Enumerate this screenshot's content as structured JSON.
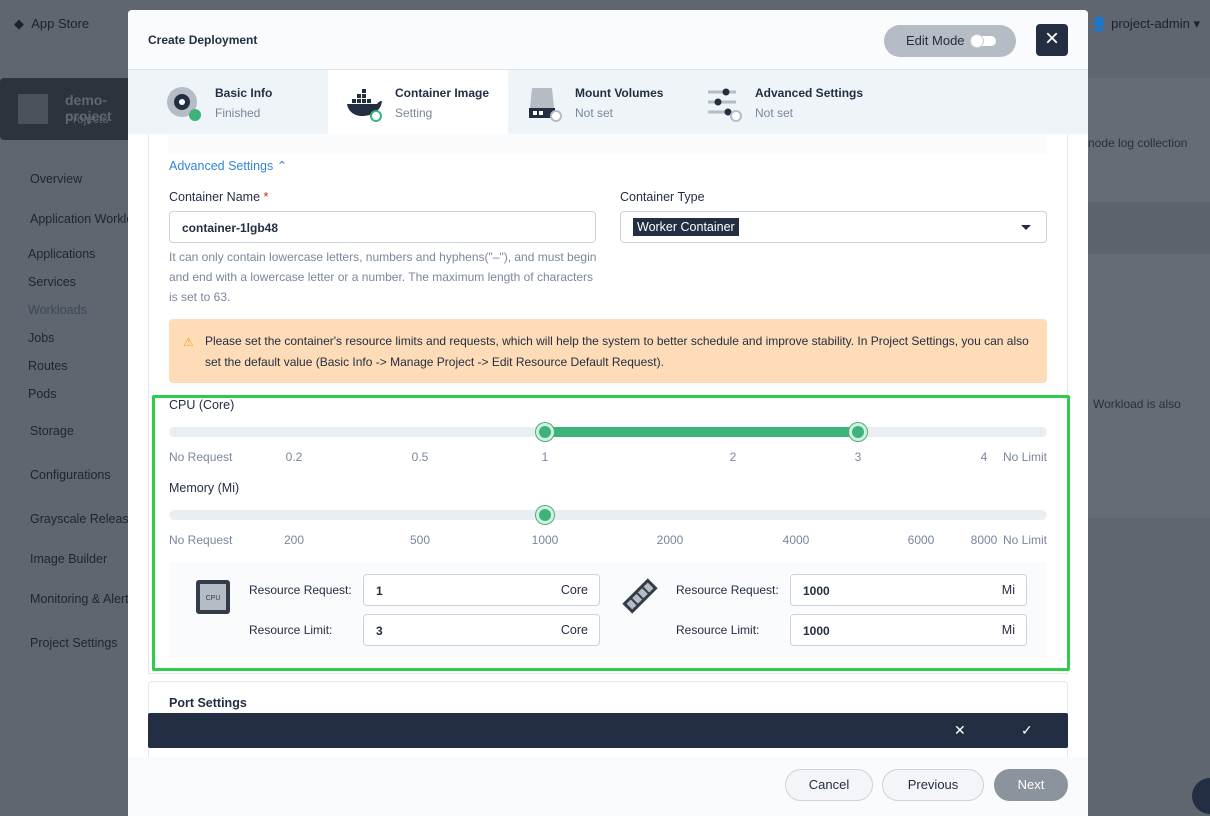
{
  "background": {
    "app_store": "App Store",
    "user": "project-admin",
    "project_name": "demo-project",
    "project_type": "Projects",
    "nav": [
      "Overview",
      "Application Workloads",
      "Applications",
      "Services",
      "Workloads",
      "Jobs",
      "Routes",
      "Pods",
      "Storage",
      "Configurations",
      "Grayscale Release",
      "Image Builder",
      "Monitoring & Alerting",
      "Project Settings"
    ],
    "right_texts": [
      "node log collection",
      "Workload is also"
    ]
  },
  "modal": {
    "title": "Create Deployment",
    "edit_mode": "Edit Mode",
    "steps": [
      {
        "label": "Basic Info",
        "status": "Finished",
        "icon": "disc-icon"
      },
      {
        "label": "Container Image",
        "status": "Setting",
        "icon": "docker-icon"
      },
      {
        "label": "Mount Volumes",
        "status": "Not set",
        "icon": "disk-icon"
      },
      {
        "label": "Advanced Settings",
        "status": "Not set",
        "icon": "sliders-icon"
      }
    ],
    "advanced_toggle": "Advanced Settings",
    "container_name_label": "Container Name",
    "required_mark": "*",
    "container_name": "container-1lgb48",
    "container_name_hint": "It can only contain lowercase letters, numbers and hyphens(\"–\"), and must begin and end with a lowercase letter or a number. The maximum length of characters is set to 63.",
    "container_type_label": "Container Type",
    "container_type": "Worker Container",
    "warning": "Please set the container's resource limits and requests, which will help the system to better schedule and improve stability. In Project Settings, you can also set the default value (Basic Info -> Manage Project -> Edit Resource Default Request).",
    "cpu": {
      "label": "CPU (Core)",
      "ticks": [
        "No Request",
        "0.2",
        "0.5",
        "1",
        "2",
        "3",
        "4",
        "No Limit"
      ],
      "request": "1",
      "limit": "3",
      "unit": "Core"
    },
    "memory": {
      "label": "Memory (Mi)",
      "ticks": [
        "No Request",
        "200",
        "500",
        "1000",
        "2000",
        "4000",
        "6000",
        "8000",
        "No Limit"
      ],
      "request": "1000",
      "limit": "1000",
      "unit": "Mi"
    },
    "resource_request_label": "Resource Request:",
    "resource_limit_label": "Resource Limit:",
    "cpu_icon_text": "CPU",
    "port_settings": "Port Settings",
    "bar_cancel": "✕",
    "bar_confirm": "✓",
    "buttons": {
      "cancel": "Cancel",
      "previous": "Previous",
      "next": "Next"
    },
    "colors": {
      "accent": "#3cb37a",
      "highlight": "#2ecc4a",
      "warning_bg": "#fddcb7"
    }
  }
}
